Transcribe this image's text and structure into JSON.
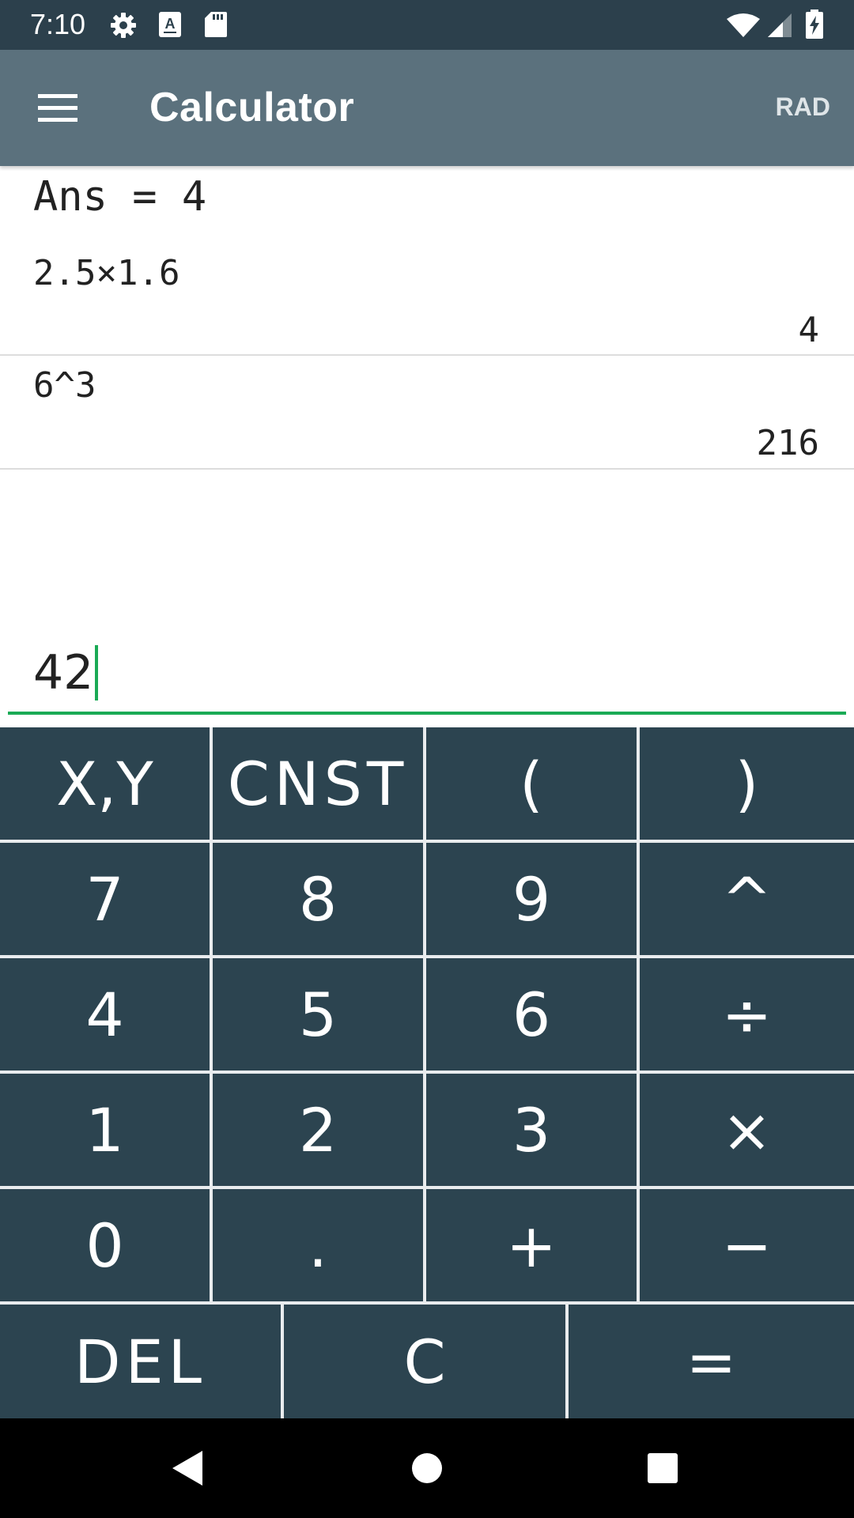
{
  "status_bar": {
    "time": "7:10",
    "left_icons": [
      "settings-icon",
      "text-notification-icon",
      "sd-card-icon"
    ],
    "right_icons": [
      "wifi-icon",
      "cell-signal-icon",
      "battery-charging-icon"
    ]
  },
  "app_bar": {
    "menu_icon": "hamburger-menu-icon",
    "title": "Calculator",
    "angle_mode": "RAD"
  },
  "history": {
    "ans": "Ans = 4",
    "entries": [
      {
        "expression": "2.5×1.6",
        "result": "4"
      },
      {
        "expression": "6^3",
        "result": "216"
      }
    ]
  },
  "input": {
    "value": "42"
  },
  "keypad": {
    "rows": [
      [
        "X,Y",
        "CNST",
        "(",
        ")"
      ],
      [
        "7",
        "8",
        "9",
        "^"
      ],
      [
        "4",
        "5",
        "6",
        "÷"
      ],
      [
        "1",
        "2",
        "3",
        "×"
      ],
      [
        "0",
        ".",
        "+",
        "−"
      ]
    ],
    "bottom_row": [
      "DEL",
      "C",
      "="
    ]
  },
  "nav_bar": {
    "buttons": [
      "back-icon",
      "home-icon",
      "recents-icon"
    ]
  },
  "colors": {
    "status_bar": "#2c404c",
    "app_bar": "#5b717d",
    "key_background": "#2c4450",
    "key_separator": "#e9ecee",
    "input_accent": "#1aaa55"
  }
}
